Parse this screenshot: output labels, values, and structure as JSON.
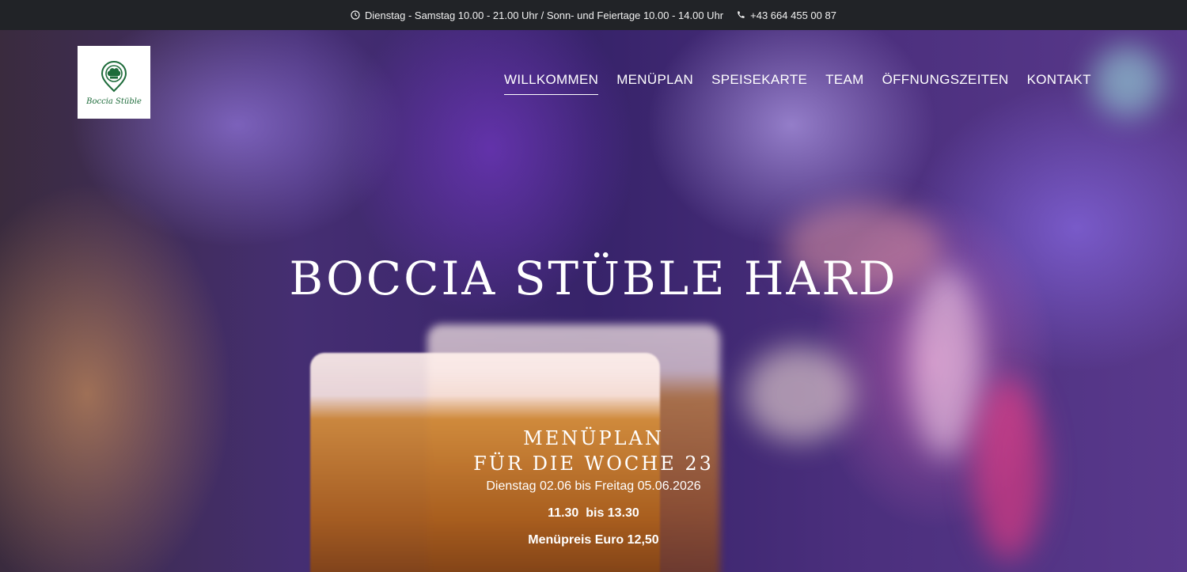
{
  "topbar": {
    "hours": "Dienstag - Samstag 10.00 - 21.00 Uhr / Sonn- und Feiertage 10.00 - 14.00 Uhr",
    "phone": "+43 664 455 00 87"
  },
  "logo": {
    "text": "Boccia Stüble"
  },
  "nav": {
    "items": [
      {
        "label": "WILLKOMMEN",
        "active": true
      },
      {
        "label": "MENÜPLAN"
      },
      {
        "label": "SPEISEKARTE"
      },
      {
        "label": "TEAM"
      },
      {
        "label": "ÖFFNUNGSZEITEN"
      },
      {
        "label": "KONTAKT"
      }
    ]
  },
  "hero": {
    "title": "BOCCIA STÜBLE HARD"
  },
  "menu": {
    "heading_line1": "MENÜPLAN",
    "heading_line2": "FÜR DIE WOCHE 23",
    "dates": "Dienstag 02.06 bis Freitag 05.06.2026",
    "time": "11.30  bis 13.30",
    "price": "Menüpreis Euro 12,50"
  },
  "colors": {
    "topbar_bg": "#212327",
    "logo_green": "#1d6b3a",
    "text": "#ffffff"
  },
  "icons": [
    "clock-icon",
    "phone-icon",
    "chef-hat-icon"
  ]
}
